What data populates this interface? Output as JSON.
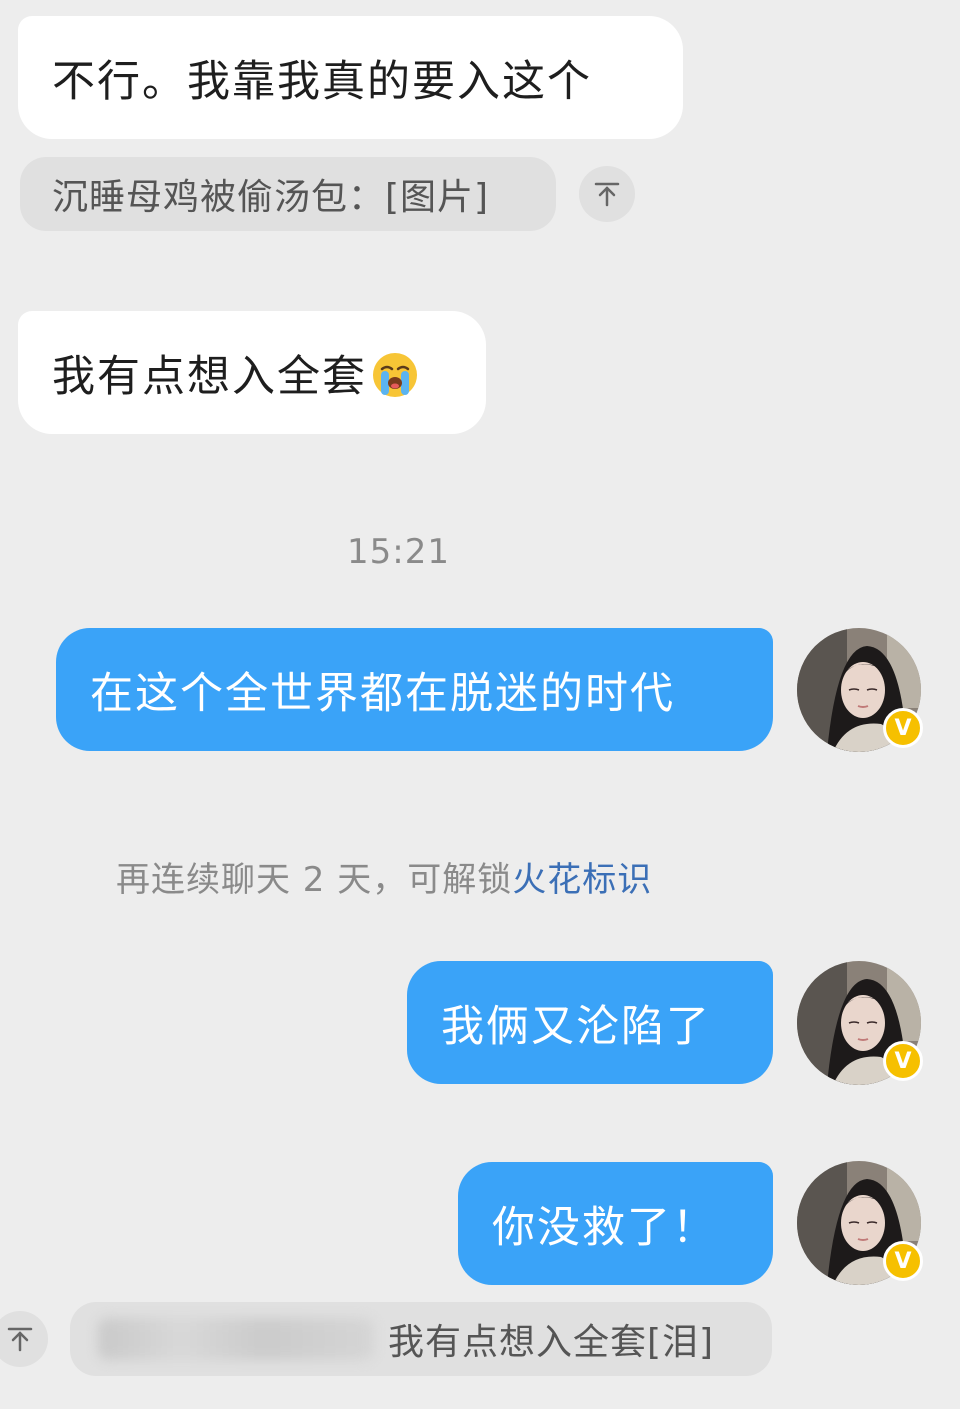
{
  "messages": {
    "m1": "不行。我靠我真的要入这个",
    "q1": "沉睡母鸡被偷汤包：[图片]",
    "m2": "我有点想入全套",
    "time": "15:21",
    "m3": "在这个全世界都在脱迷的时代",
    "system_prefix": "再连续聊天 2 天，可解锁",
    "system_link": "火花标识",
    "m4": "我俩又沦陷了",
    "m5": "你没救了！",
    "q2": "我有点想入全套[泪]"
  },
  "badge": {
    "letter": "V"
  },
  "icons": {
    "cry": "loudly-crying-face-icon",
    "quote_arrow": "quote-jump-arrow-icon",
    "verified": "verified-badge-icon"
  },
  "colors": {
    "background": "#ededed",
    "incoming_bubble": "#ffffff",
    "outgoing_bubble": "#3aa3f8",
    "quote_bubble": "#e0e0e0",
    "link": "#3b6fb6",
    "badge": "#f6c000"
  }
}
